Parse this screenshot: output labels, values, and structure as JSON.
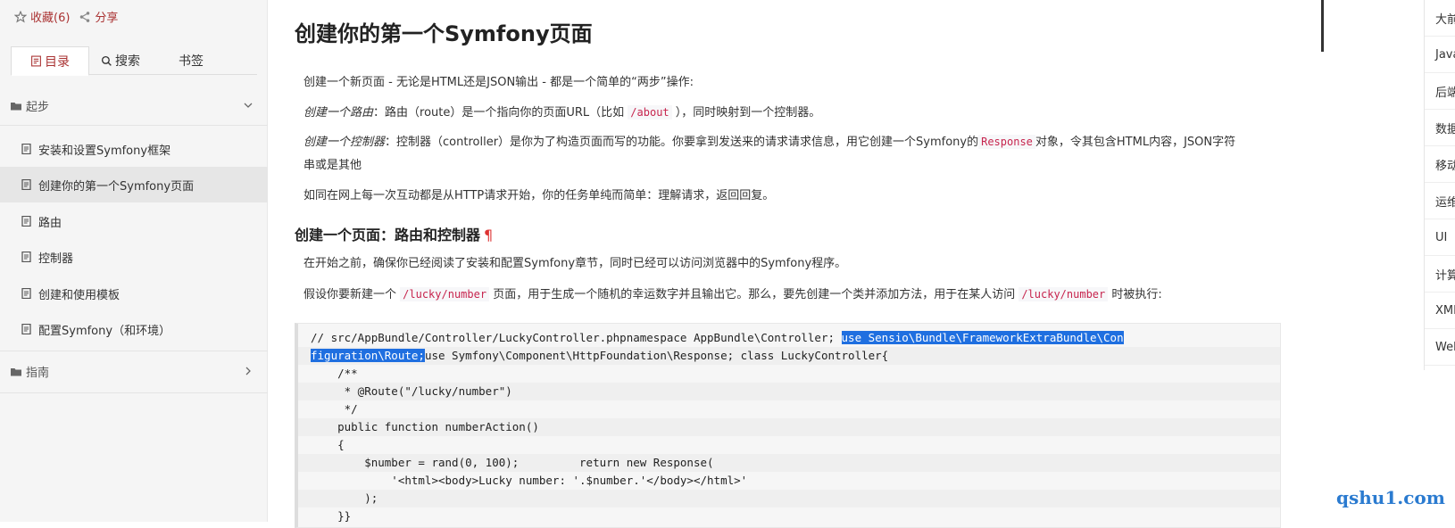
{
  "sidebar": {
    "favorite_label": "收藏(6)",
    "share_label": "分享",
    "tabs": {
      "toc": "目录",
      "search": "搜索",
      "bookmark": "书签"
    },
    "sections": [
      {
        "label": "起步"
      },
      {
        "label": "指南"
      }
    ],
    "items": [
      {
        "label": "安装和设置Symfony框架"
      },
      {
        "label": "创建你的第一个Symfony页面"
      },
      {
        "label": "路由"
      },
      {
        "label": "控制器"
      },
      {
        "label": "创建和使用模板"
      },
      {
        "label": "配置Symfony（和环境）"
      }
    ]
  },
  "main": {
    "title": "创建你的第一个Symfony页面",
    "intro": "创建一个新页面 - 无论是HTML还是JSON输出 - 都是一个简单的“两步”操作:",
    "route_em": "创建一个路由",
    "route_text_a": "：路由（route）是一个指向你的页面URL（比如 ",
    "route_code": "/about",
    "route_text_b": " ），同时映射到一个控制器。",
    "controller_em": "创建一个控制器",
    "controller_text_a": "：控制器（controller）是你为了构造页面而写的功能。你要拿到发送来的请求请求信息，用它创建一个Symfony的",
    "controller_code": "Response",
    "controller_text_b": "对象，令其包含HTML内容，JSON字符",
    "controller_text_c": "串或是其他",
    "http_text": "如同在网上每一次互动都是从HTTP请求开始，你的任务单纯而简单：理解请求，返回回复。",
    "h2": "创建一个页面：路由和控制器",
    "h2_pilcrow": "¶",
    "before_text": "在开始之前，确保你已经阅读了安装和配置Symfony章节，同时已经可以访问浏览器中的Symfony程序。",
    "lucky_a": "假设你要新建一个 ",
    "lucky_code1": "/lucky/number",
    "lucky_b": " 页面，用于生成一个随机的幸运数字并且输出它。那么，要先创建一个类并添加方法，用于在某人访问 ",
    "lucky_code2": "/lucky/number",
    "lucky_c": " 时被执行:"
  },
  "code": {
    "line1_a": "// src/AppBundle/Controller/LuckyController.phpnamespace AppBundle\\Controller; ",
    "line1_sel": "use Sensio\\Bundle\\FrameworkExtraBundle\\Con",
    "line2_sel": "figuration\\Route;",
    "line2_b": "use Symfony\\Component\\HttpFoundation\\Response; class LuckyController{",
    "line3": "    /**",
    "line4": "     * @Route(\"/lucky/number\")",
    "line5": "     */",
    "line6": "    public function numberAction()",
    "line7": "    {",
    "line8": "        $number = rand(0, 100);         return new Response(",
    "line9": "            '<html><body>Lucky number: '.$number.'</body></html>'",
    "line10": "        );",
    "line11": "    }}"
  },
  "right_nav": [
    "大前",
    "Java",
    "后端",
    "数据",
    "移动",
    "运维",
    "UI",
    "计算",
    "XML",
    "Web"
  ],
  "watermark": "qshu1.com"
}
